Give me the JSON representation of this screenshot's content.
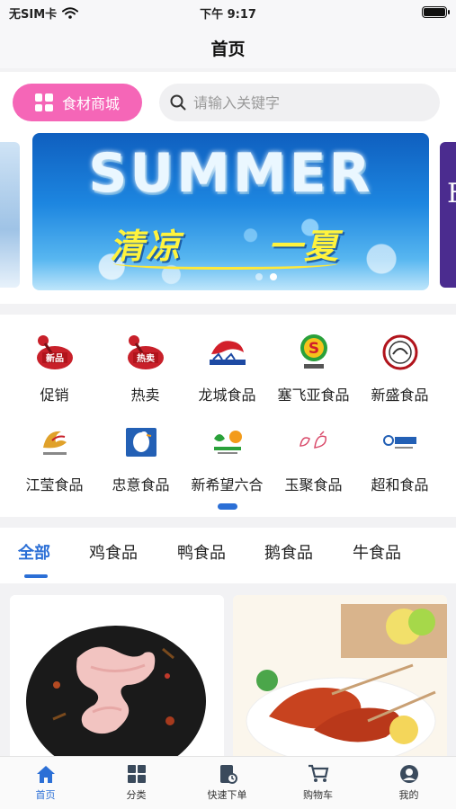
{
  "status_bar": {
    "carrier": "无SIM卡",
    "time": "下午 9:17"
  },
  "nav": {
    "title": "首页"
  },
  "search": {
    "mall_button": "食材商城",
    "placeholder": "请输入关键字"
  },
  "banner": {
    "title": "SUMMER",
    "subtitle_left": "清凉",
    "subtitle_right": "一夏",
    "right_card_letter": "F",
    "dots": 2,
    "active_dot": 1
  },
  "brands": [
    {
      "label": "促销",
      "icon": "promo-badge-icon"
    },
    {
      "label": "热卖",
      "icon": "hot-sale-badge-icon"
    },
    {
      "label": "龙城食品",
      "icon": "dragon-logo-icon"
    },
    {
      "label": "塞飞亚食品",
      "icon": "s-circle-logo-icon"
    },
    {
      "label": "新盛食品",
      "icon": "round-badge-logo-icon"
    },
    {
      "label": "江莹食品",
      "icon": "bird-logo-icon"
    },
    {
      "label": "忠意食品",
      "icon": "duck-logo-icon"
    },
    {
      "label": "新希望六合",
      "icon": "new-hope-logo-icon"
    },
    {
      "label": "玉聚食品",
      "icon": "poultry-sketch-logo-icon"
    },
    {
      "label": "超和食品",
      "icon": "chaohe-logo-icon"
    }
  ],
  "category_tabs": [
    "全部",
    "鸡食品",
    "鸭食品",
    "鹅食品",
    "牛食品"
  ],
  "active_tab": 0,
  "products": [
    {
      "image": "raw-chicken-wings-photo"
    },
    {
      "image": "grilled-wings-skewer-photo"
    }
  ],
  "tabbar": [
    {
      "label": "首页",
      "icon": "home-icon",
      "active": true
    },
    {
      "label": "分类",
      "icon": "category-grid-icon",
      "active": false
    },
    {
      "label": "快速下单",
      "icon": "quick-order-icon",
      "active": false
    },
    {
      "label": "购物车",
      "icon": "cart-icon",
      "active": false
    },
    {
      "label": "我的",
      "icon": "profile-icon",
      "active": false
    }
  ],
  "colors": {
    "accent": "#2b6fd6",
    "mall_button": "#f566b7"
  }
}
